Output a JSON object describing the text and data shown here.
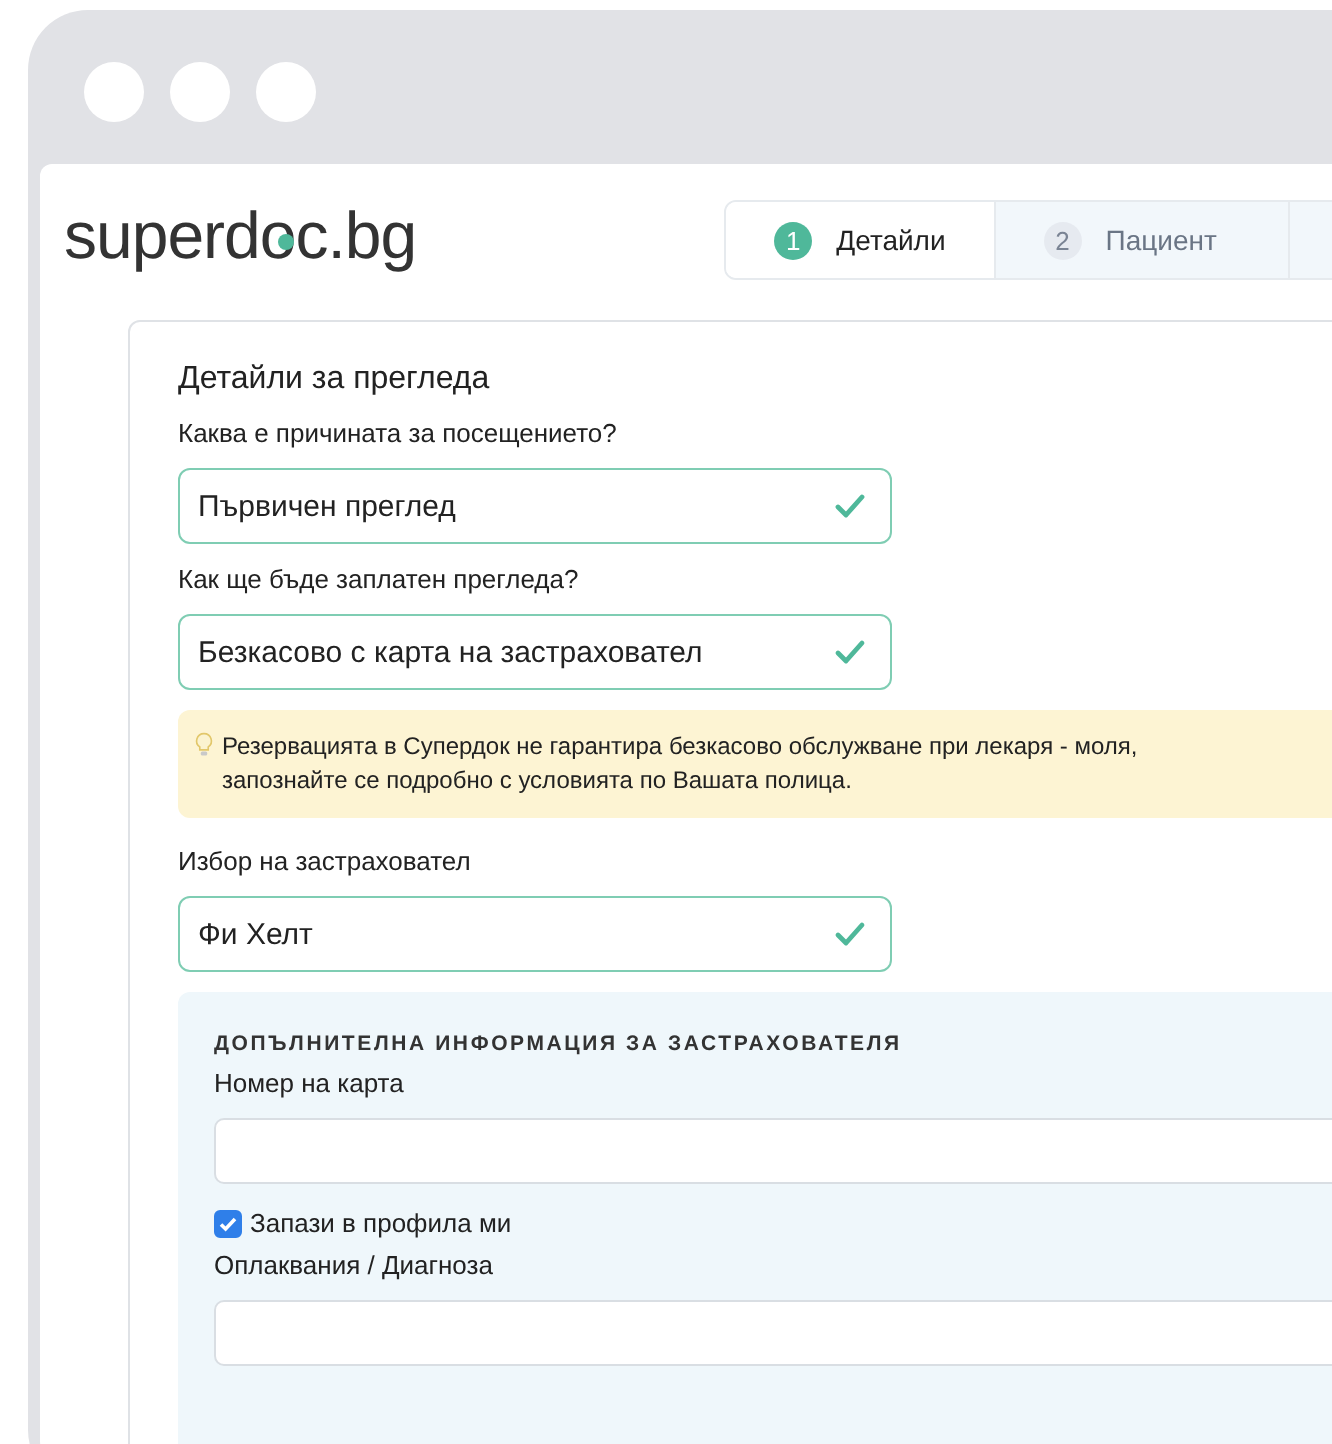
{
  "logo": "superdoc.bg",
  "steps": [
    {
      "number": "1",
      "label": "Детайли",
      "selected": true
    },
    {
      "number": "2",
      "label": "Пациент",
      "selected": false
    }
  ],
  "form": {
    "title": "Детайли за прегледа",
    "fields": [
      {
        "label": "Каква е причината за посещението?",
        "value": "Първичен преглед",
        "valid": true
      },
      {
        "label": "Как ще бъде заплатен прегледа?",
        "value": "Безкасово с карта на застраховател",
        "valid": true
      }
    ],
    "notice": "Резервацията в Супердок не гарантира безкасово обслужване при лекаря - моля, запознайте се подробно с условията по Вашата полица.",
    "insurer_field": {
      "label": "Избор на застраховател",
      "value": "Фи Хелт",
      "valid": true
    },
    "insurer_panel": {
      "heading": "ДОПЪЛНИТЕЛНА ИНФОРМАЦИЯ ЗА ЗАСТРАХОВАТЕЛЯ",
      "card_label": "Номер на карта",
      "save_checkbox": {
        "label": "Запази в профила ми",
        "checked": true
      },
      "diagnosis_label": "Оплаквания / Диагноза"
    }
  }
}
